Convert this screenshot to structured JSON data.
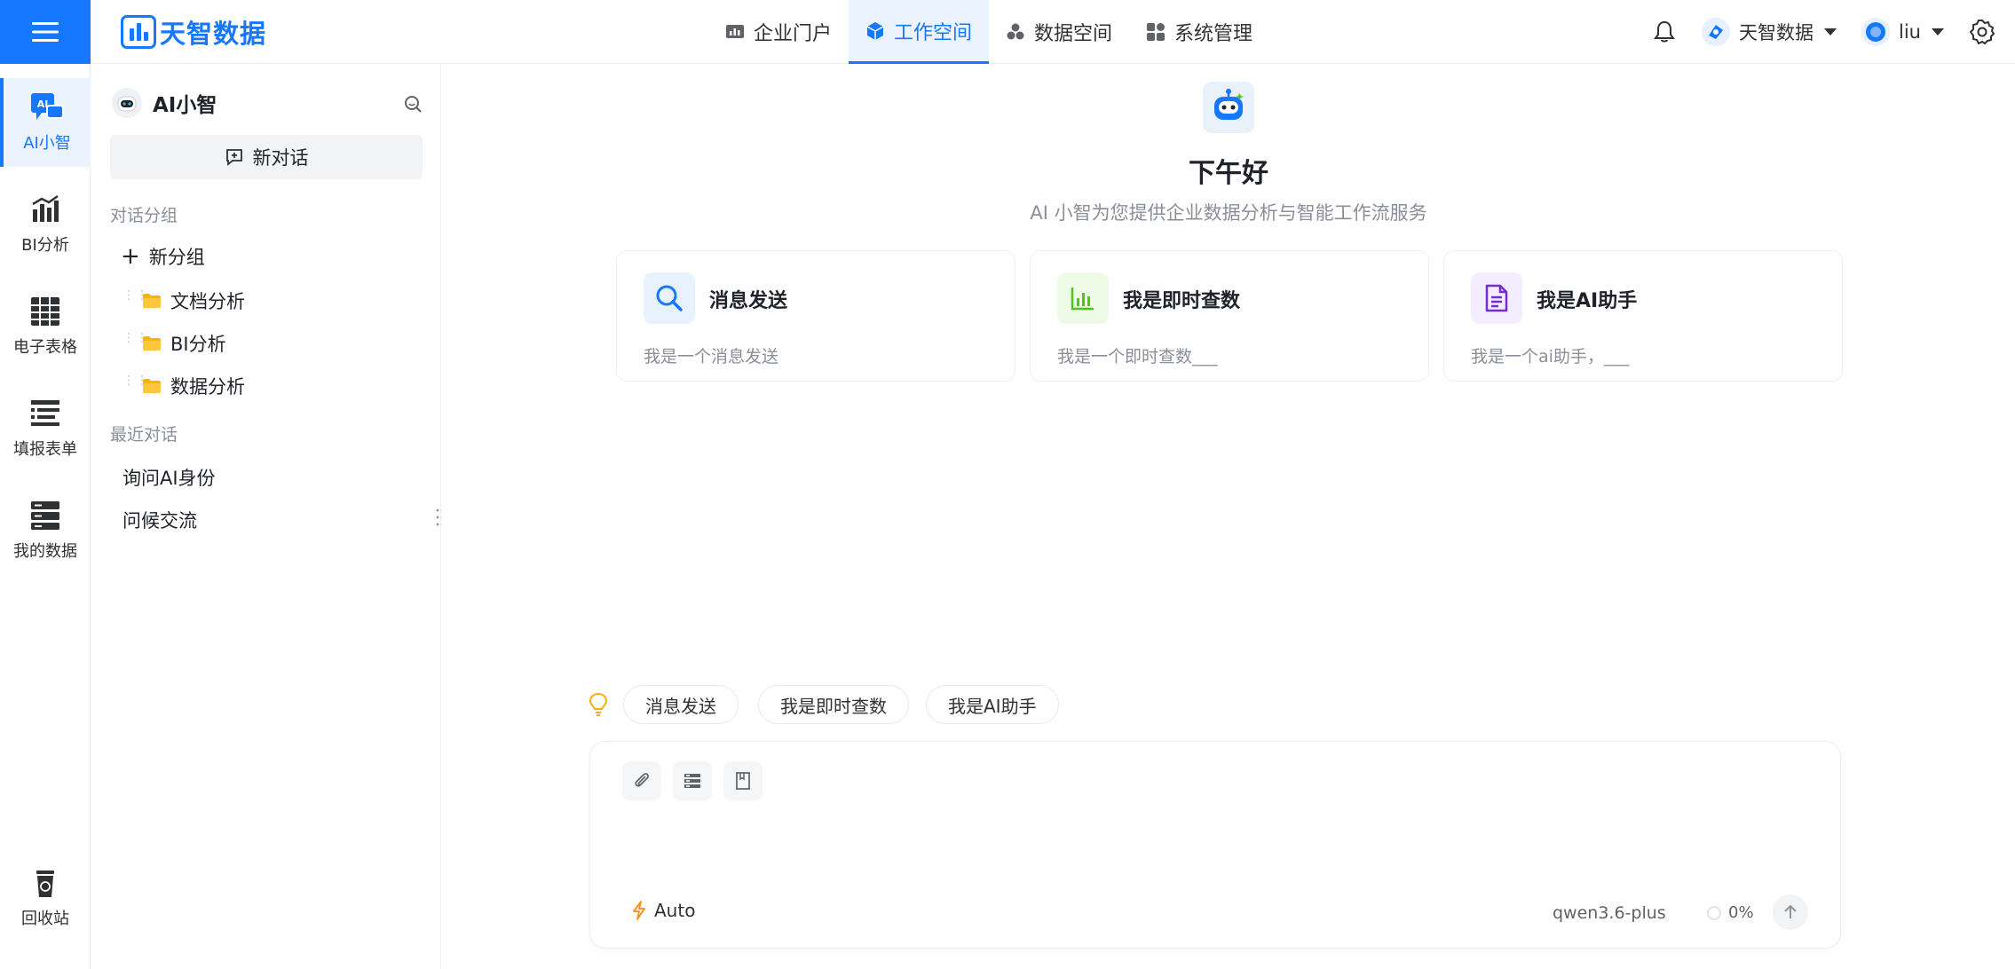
{
  "brand": {
    "name": "天智数据",
    "accent": "#1677ff"
  },
  "header": {
    "nav": [
      {
        "label": "企业门户",
        "icon": "chart-board-icon"
      },
      {
        "label": "工作空间",
        "icon": "cube-icon",
        "active": true
      },
      {
        "label": "数据空间",
        "icon": "cubes-icon"
      },
      {
        "label": "系统管理",
        "icon": "grid-apps-icon"
      }
    ],
    "tenant_label": "天智数据",
    "user_label": "liu"
  },
  "rail": {
    "items": [
      {
        "label": "AI小智",
        "icon": "ai-chat-icon",
        "active": true
      },
      {
        "label": "BI分析",
        "icon": "bar-chart-icon"
      },
      {
        "label": "电子表格",
        "icon": "spreadsheet-icon"
      },
      {
        "label": "填报表单",
        "icon": "form-icon"
      },
      {
        "label": "我的数据",
        "icon": "database-icon"
      }
    ],
    "recycle_label": "回收站"
  },
  "sidebar": {
    "title": "AI小智",
    "new_chat_label": "新对话",
    "groups_label": "对话分组",
    "add_group_label": "新分组",
    "folders": [
      "文档分析",
      "BI分析",
      "数据分析"
    ],
    "recent_label": "最近对话",
    "recent": [
      "询问AI身份",
      "问候交流"
    ]
  },
  "main": {
    "greeting": "下午好",
    "subtitle": "AI 小智为您提供企业数据分析与智能工作流服务",
    "cards": [
      {
        "title": "消息发送",
        "desc": "我是一个消息发送",
        "icon": "search-icon",
        "color": "#1677ff"
      },
      {
        "title": "我是即时查数",
        "desc": "我是一个即时查数___",
        "icon": "bar-chart-icon",
        "color": "#52c41a"
      },
      {
        "title": "我是AI助手",
        "desc": "我是一个ai助手，___",
        "icon": "document-icon",
        "color": "#722ed1"
      }
    ],
    "suggestions": [
      "消息发送",
      "我是即时查数",
      "我是AI助手"
    ],
    "composer": {
      "mode_label": "Auto",
      "model_label": "qwen3.6-plus",
      "usage_percent": "0%"
    }
  }
}
